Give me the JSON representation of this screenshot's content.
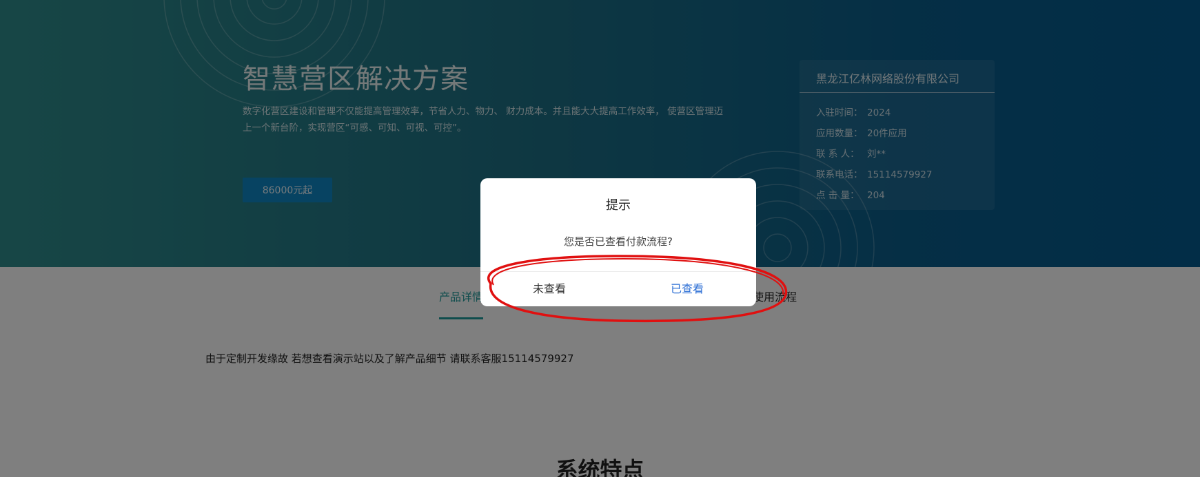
{
  "hero": {
    "title": "智慧营区解决方案",
    "description": "数字化营区建设和管理不仅能提高管理效率，节省人力、物力、 财力成本。并且能大大提高工作效率， 使营区管理迈上一个新台阶，实现营区“可感、可知、可视、可控”。",
    "price_button": "86000元起"
  },
  "company": {
    "name": "黑龙江亿林网络股份有限公司",
    "rows": [
      {
        "label": "入驻时间：",
        "value": "2024"
      },
      {
        "label": "应用数量：",
        "value": "20件应用"
      },
      {
        "label": "联 系 人：",
        "value": "刘**"
      },
      {
        "label": "联系电话：",
        "value": "15114579927"
      },
      {
        "label": "点 击 量：",
        "value": "204"
      }
    ]
  },
  "tabs": {
    "product_detail": "产品详情",
    "usage_flow": "使用流程"
  },
  "content": {
    "notice": "由于定制开发缘故 若想查看演示站以及了解产品细节 请联系客服15114579927",
    "section_title": "系统特点"
  },
  "modal": {
    "title": "提示",
    "message": "您是否已查看付款流程?",
    "cancel_label": "未查看",
    "confirm_label": "已查看"
  },
  "colors": {
    "accent_teal": "#1f9a9a",
    "confirm_blue": "#2d6fd5",
    "annotation_red": "#e01010"
  }
}
